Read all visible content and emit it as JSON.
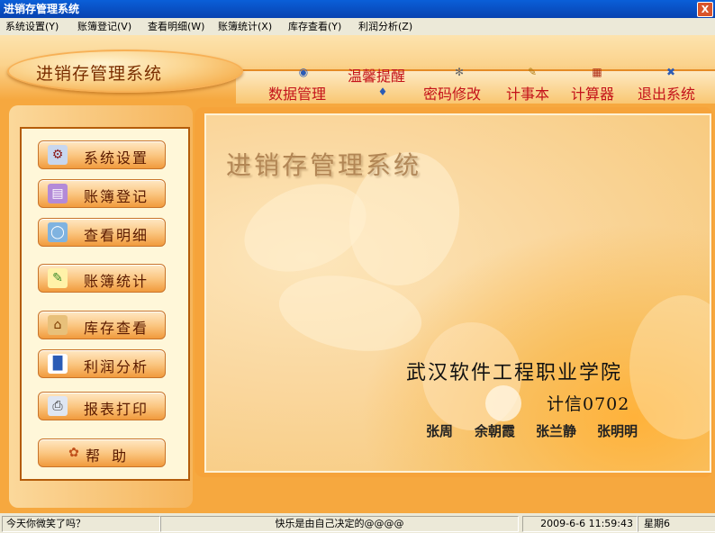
{
  "window": {
    "title": "进销存管理系统",
    "close_label": "X"
  },
  "menu": [
    "系统设置(Y)",
    "账簿登记(V)",
    "查看明细(W)",
    "账簿统计(X)",
    "库存查看(Y)",
    "利润分析(Z)"
  ],
  "logo": {
    "text": "进销存管理系统"
  },
  "toolbar": {
    "items": [
      {
        "label": "数据管理",
        "icon": "database-icon"
      },
      {
        "label": "温馨提醒",
        "icon": "bell-icon"
      },
      {
        "label": "密码修改",
        "icon": "key-icon"
      },
      {
        "label": "计事本",
        "icon": "notepad-icon"
      },
      {
        "label": "计算器",
        "icon": "calculator-icon"
      },
      {
        "label": "退出系统",
        "icon": "exit-icon"
      }
    ]
  },
  "nav": {
    "items": [
      {
        "label": "系统设置",
        "icon": "settings-icon"
      },
      {
        "label": "账簿登记",
        "icon": "ledger-icon"
      },
      {
        "label": "查看明细",
        "icon": "details-icon"
      },
      {
        "label": "账簿统计",
        "icon": "statistics-icon"
      },
      {
        "label": "库存查看",
        "icon": "warehouse-icon"
      },
      {
        "label": "利润分析",
        "icon": "chart-icon"
      },
      {
        "label": "报表打印",
        "icon": "printer-icon"
      },
      {
        "label": "帮 助",
        "icon": "help-icon"
      }
    ]
  },
  "content": {
    "watermark_title": "进销存管理系统",
    "school": "武汉软件工程职业学院",
    "class_name": "计信0702",
    "members": [
      "张周",
      "余朝霞",
      "张兰静",
      "张明明"
    ]
  },
  "statusbar": {
    "greeting": "今天你微笑了吗？",
    "motto": "快乐是由自己决定的@@@@",
    "datetime": "2009-6-6 11:59:43",
    "weekday": "星期6"
  },
  "colors": {
    "accent": "#f6a83f",
    "label_red": "#c4121a",
    "titlebar_blue": "#0a5fd8"
  }
}
